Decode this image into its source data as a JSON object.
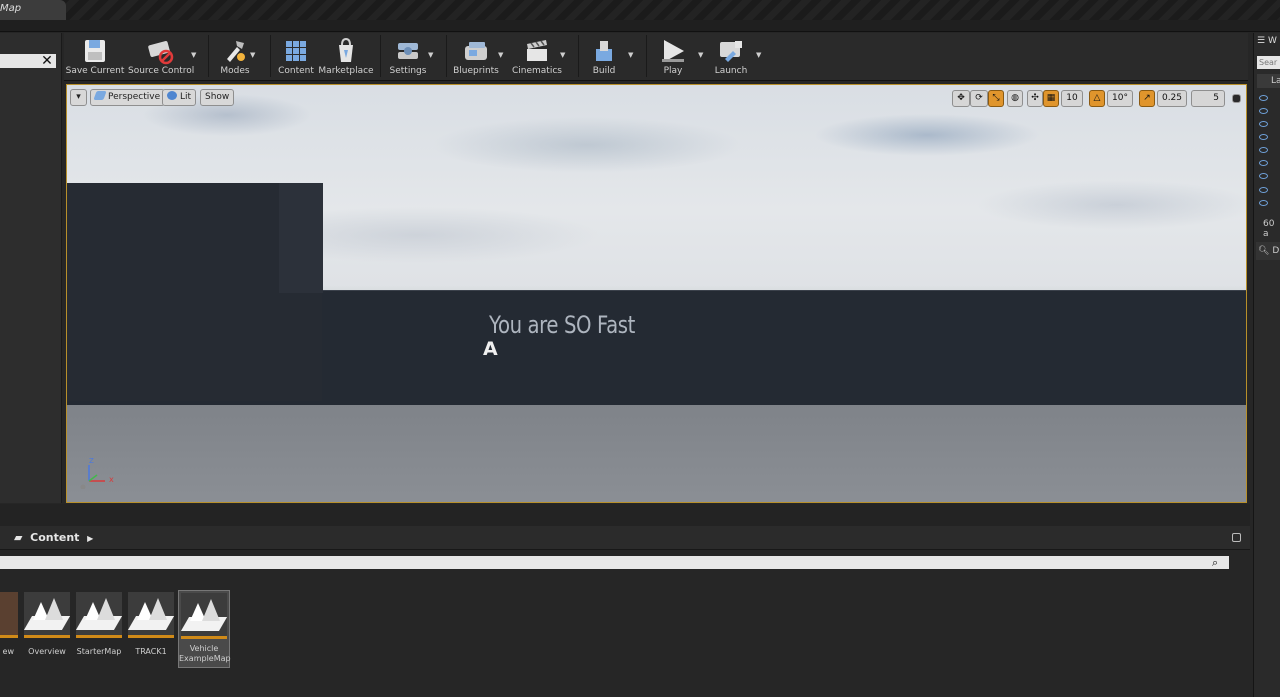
{
  "window": {
    "tab_title": "Map"
  },
  "toolbar": {
    "buttons": [
      {
        "label": "Save Current",
        "icon": "floppy-disk-icon"
      },
      {
        "label": "Source Control",
        "icon": "source-control-icon"
      },
      {
        "label": "Modes",
        "icon": "modes-icon"
      },
      {
        "label": "Content",
        "icon": "content-grid-icon"
      },
      {
        "label": "Marketplace",
        "icon": "marketplace-icon"
      },
      {
        "label": "Settings",
        "icon": "settings-gear-icon"
      },
      {
        "label": "Blueprints",
        "icon": "blueprints-icon"
      },
      {
        "label": "Cinematics",
        "icon": "clapperboard-icon"
      },
      {
        "label": "Build",
        "icon": "build-icon"
      },
      {
        "label": "Play",
        "icon": "play-icon"
      },
      {
        "label": "Launch",
        "icon": "launch-icon"
      }
    ]
  },
  "viewport": {
    "options_menu": "▾",
    "view_mode": "Perspective",
    "lighting": "Lit",
    "show": "Show",
    "grid_snap": "10",
    "rotation_snap": "10°",
    "scale_snap": "0.25",
    "camera_speed": "5",
    "scene_text": "You are SO Fast",
    "cursor_glyph": "A",
    "axis_z": "Z",
    "axis_x": "x"
  },
  "right_panel": {
    "title_fragment": "W",
    "search_placeholder": "Sear",
    "column_fragment": "La",
    "count_fragment": "60 a",
    "details_fragment": "D"
  },
  "content_browser": {
    "path": "Content",
    "assets": [
      {
        "name": "ew"
      },
      {
        "name": "Overview"
      },
      {
        "name": "StarterMap"
      },
      {
        "name": "TRACK1"
      },
      {
        "name": "Vehicle ExampleMap",
        "selected": true
      }
    ]
  },
  "colors": {
    "accent": "#e0952c",
    "viewport_border": "#b8902a",
    "panel_bg": "#262626"
  }
}
